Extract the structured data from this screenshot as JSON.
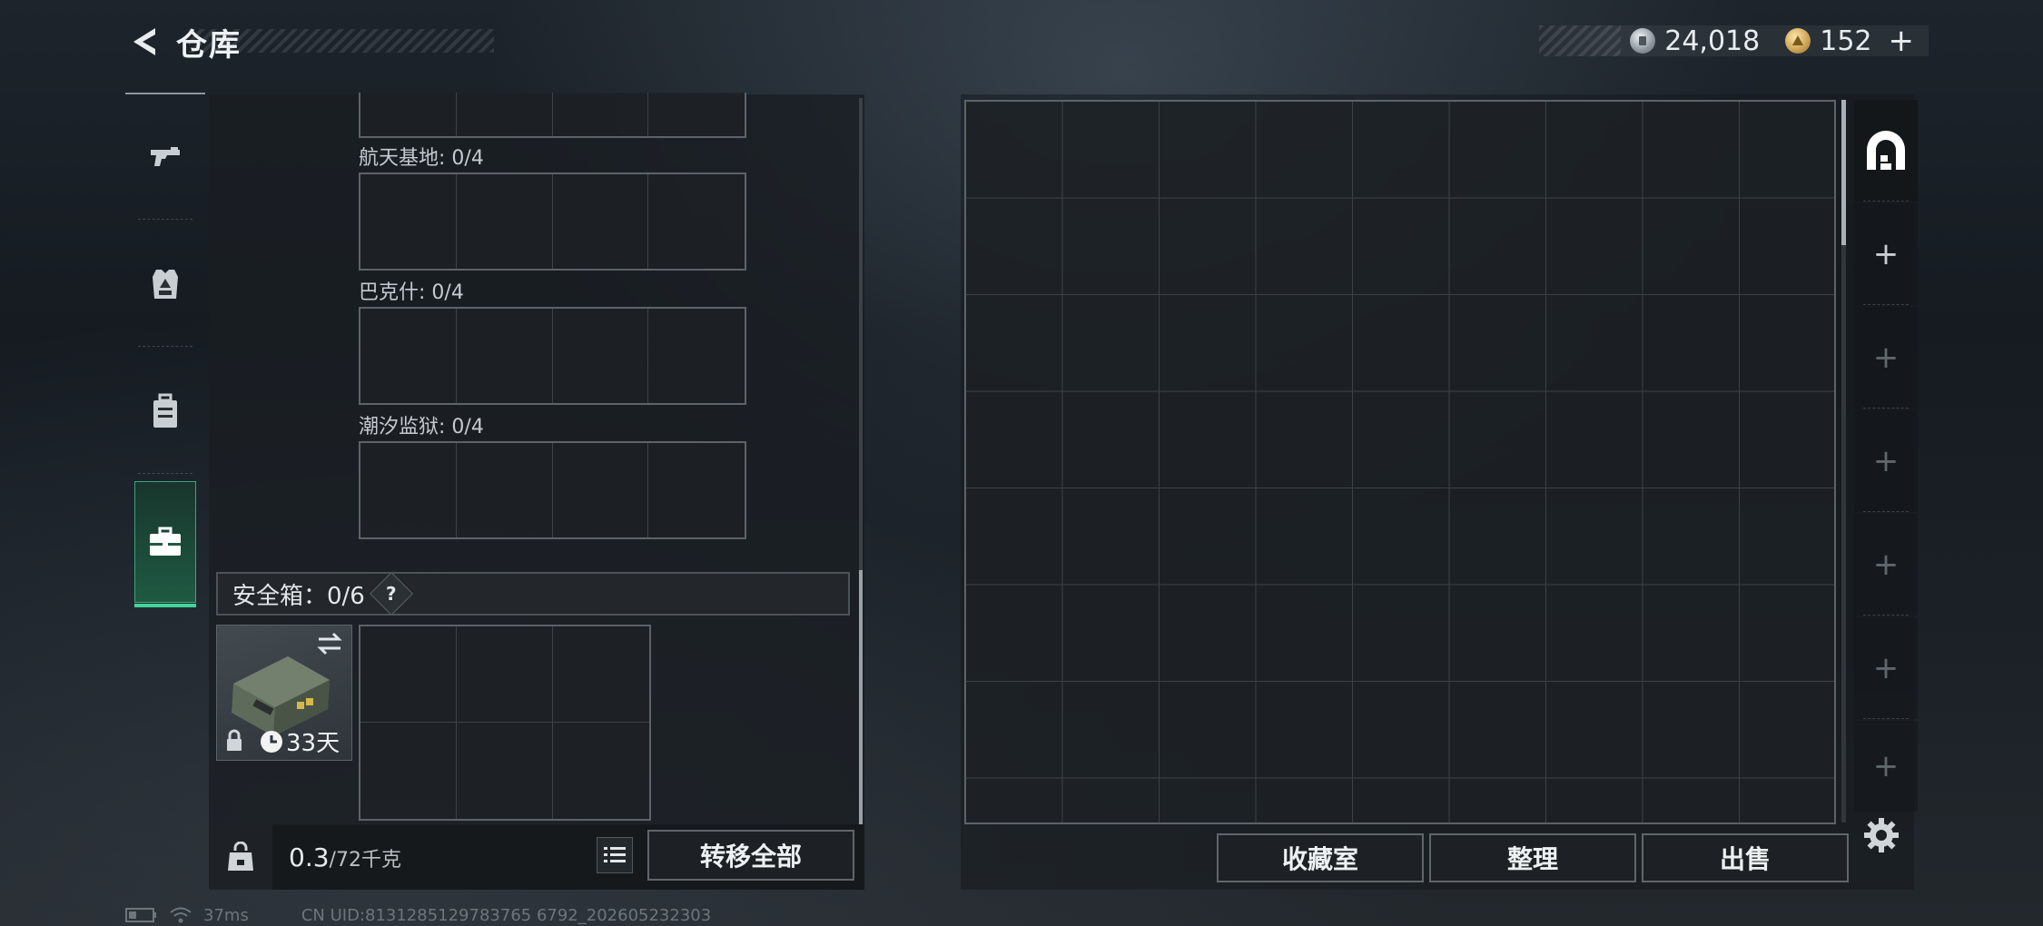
{
  "header": {
    "title": "仓库",
    "silver_amount": "24,018",
    "gold_amount": "152"
  },
  "left_tabs": [
    {
      "name": "weapons",
      "icon": "gun-icon"
    },
    {
      "name": "armor",
      "icon": "vest-icon"
    },
    {
      "name": "backpack",
      "icon": "backpack-icon"
    },
    {
      "name": "cases",
      "icon": "briefcase-icon",
      "active": true
    }
  ],
  "storage": {
    "maps": [
      {
        "label": "航天基地: 0/4"
      },
      {
        "label": "巴克什: 0/4"
      },
      {
        "label": "潮汐监狱: 0/4"
      }
    ],
    "safe_box": {
      "label": "安全箱：0/6",
      "help": "?",
      "item_days": "33天"
    },
    "weight_value": "0.3",
    "weight_cap": "/72千克",
    "transfer_all": "转移全部"
  },
  "warehouse": {
    "buttons": {
      "collection": "收藏室",
      "organize": "整理",
      "sell": "出售"
    }
  },
  "side_tabs": {
    "plus": "+"
  },
  "status_bar": {
    "ping": "37ms",
    "uid": "CN UID:8131285129783765 6792_202605232303"
  },
  "colors": {
    "accent_green": "#41d59a",
    "panel_border": "#5c6369"
  }
}
